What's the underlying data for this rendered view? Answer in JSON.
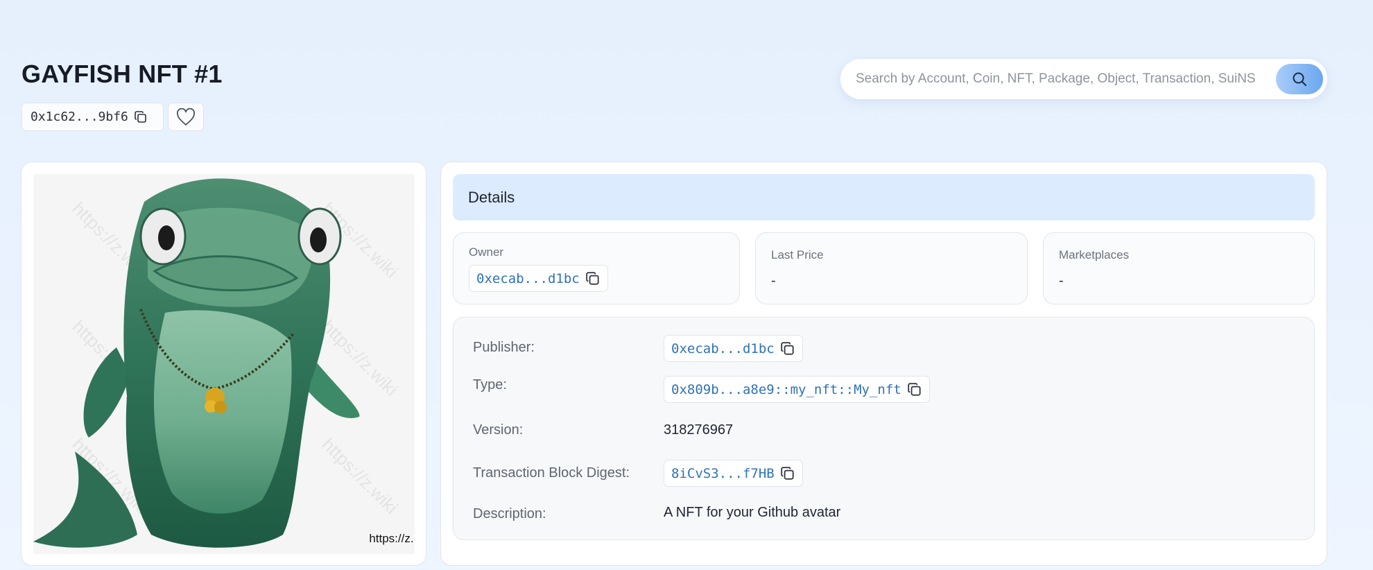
{
  "header": {
    "title": "GAYFISH NFT #1",
    "object_id_short": "0x1c62...9bf6",
    "favorite_icon": "heart-icon"
  },
  "search": {
    "placeholder": "Search by Account, Coin, NFT, Package, Object, Transaction, SuiNS",
    "button_icon": "search-icon"
  },
  "image": {
    "watermark_text": "https://z.wiki",
    "caption": "https://z. "
  },
  "details": {
    "tab_label": "Details",
    "stats": {
      "owner_label": "Owner",
      "owner_value": "0xecab...d1bc",
      "last_price_label": "Last Price",
      "last_price_value": "-",
      "marketplaces_label": "Marketplaces",
      "marketplaces_value": "-"
    },
    "properties": {
      "publisher_label": "Publisher:",
      "publisher_value": "0xecab...d1bc",
      "type_label": "Type:",
      "type_value": "0x809b...a8e9::my_nft::My_nft",
      "version_label": "Version:",
      "version_value": "318276967",
      "digest_label": "Transaction Block Digest:",
      "digest_value": "8iCvS3...f7HB",
      "description_label": "Description:",
      "description_value": "A NFT for your Github avatar"
    }
  },
  "colors": {
    "link": "#2f72b7",
    "tab_bg": "#dcebfd",
    "search_button": "#6ba7f0"
  }
}
